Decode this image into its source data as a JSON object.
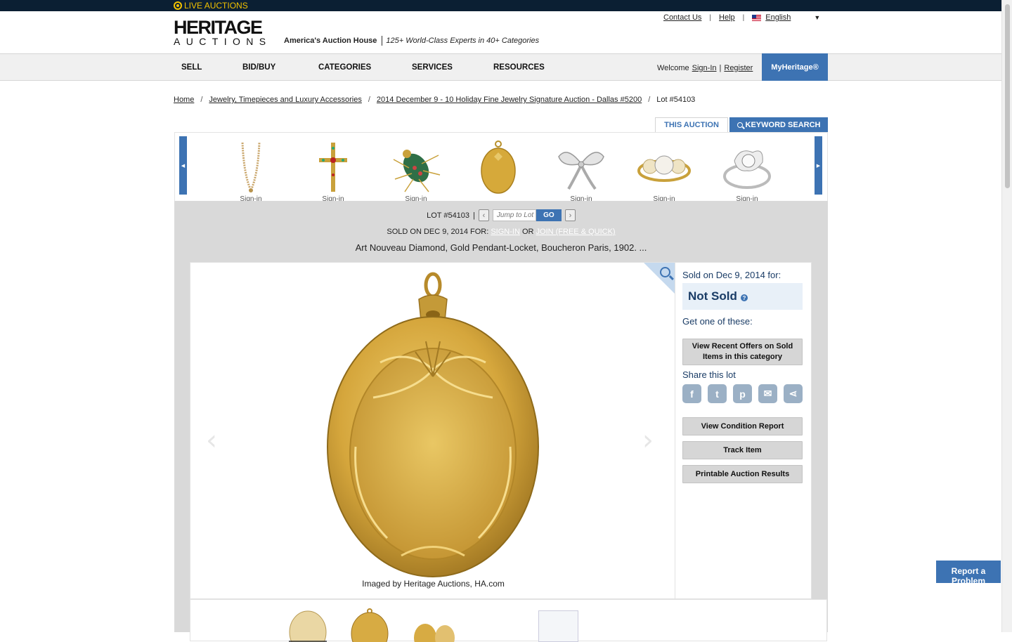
{
  "topbar": {
    "live_label": "LIVE AUCTIONS"
  },
  "header": {
    "logo_line1": "HERITAGE",
    "logo_line2": "AUCTIONS",
    "tagline_bold": "America's Auction House",
    "tagline_italic": "125+ World-Class Experts in 40+ Categories",
    "links": {
      "contact": "Contact Us",
      "help": "Help",
      "language": "English"
    }
  },
  "nav": {
    "items": [
      "SELL",
      "BID/BUY",
      "CATEGORIES",
      "SERVICES",
      "RESOURCES"
    ],
    "welcome": "Welcome",
    "sign_in": "Sign-In",
    "register": "Register",
    "myheritage": "MyHeritage®"
  },
  "breadcrumb": {
    "home": "Home",
    "category": "Jewelry, Timepieces and Luxury Accessories",
    "auction": "2014 December 9 - 10 Holiday Fine Jewelry Signature Auction - Dallas #5200",
    "lot": "Lot #54103"
  },
  "tabs": {
    "this_auction": "THIS AUCTION",
    "keyword_search": "KEYWORD SEARCH"
  },
  "carousel": {
    "items": [
      {
        "icon": "necklace-thumbnail",
        "caption": "Sign-in"
      },
      {
        "icon": "cross-pendant-thumbnail",
        "caption": "Sign-in"
      },
      {
        "icon": "insect-brooch-thumbnail",
        "caption": "Sign-in"
      },
      {
        "icon": "oval-locket-thumbnail",
        "caption": ""
      },
      {
        "icon": "bow-brooch-thumbnail",
        "caption": "Sign-in"
      },
      {
        "icon": "pearl-ring-thumbnail",
        "caption": "Sign-in"
      },
      {
        "icon": "diamond-ring-thumbnail",
        "caption": "Sign-in"
      }
    ]
  },
  "lot": {
    "lot_number": "LOT #54103",
    "separator": "|",
    "jump_placeholder": "Jump to Lot",
    "go": "GO",
    "sold_prefix": "SOLD ON DEC 9, 2014 FOR:",
    "sign_in": "SIGN-IN",
    "or": "OR",
    "join": "JOIN (FREE & QUICK)",
    "title": "Art Nouveau Diamond, Gold Pendant-Locket, Boucheron Paris, 1902. ...",
    "image_caption": "Imaged by Heritage Auctions, HA.com"
  },
  "side": {
    "sold_on": "Sold on Dec 9, 2014 for:",
    "status": "Not Sold",
    "get_one": "Get one of these:",
    "view_offers": "View Recent Offers on Sold Items in this category",
    "share_label": "Share this lot",
    "condition": "View Condition Report",
    "track": "Track Item",
    "printable": "Printable Auction Results"
  },
  "report_problem": "Report a Problem",
  "colors": {
    "accent": "#3d73b3",
    "topbar": "#0b1f33",
    "gold": "#c9a13b",
    "live": "#f2c200"
  }
}
